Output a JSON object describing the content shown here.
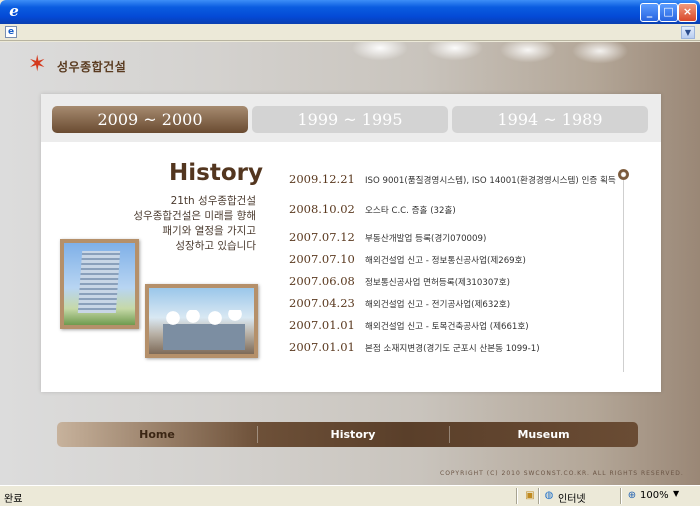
{
  "window": {
    "min_glyph": "_",
    "max_glyph": "□",
    "close_glyph": "×"
  },
  "brand": {
    "logo_text": "성우종합건설",
    "accent": "#6a4b31",
    "star_color": "#d43a1e"
  },
  "tabs": [
    {
      "label": "2009 ~ 2000",
      "active": true
    },
    {
      "label": "1999 ~ 1995",
      "active": false
    },
    {
      "label": "1994 ~ 1989",
      "active": false
    }
  ],
  "intro": {
    "title": "History",
    "line1": "21th 성우종합건설",
    "line2": "성우종합건설은 미래를 향해",
    "line3": "패기와 열정을 가지고",
    "line4": "성장하고 있습니다"
  },
  "timeline": [
    {
      "date": "2009.12.21",
      "event": "ISO 9001(품질경영시스템), ISO 14001(환경경영시스템) 인증 획득"
    },
    {
      "date": "2008.10.02",
      "event": "오스타 C.C. 증홀 (32홀)"
    },
    {
      "date": "2007.07.12",
      "event": "부동산개발업 등록(경기070009)"
    },
    {
      "date": "2007.07.10",
      "event": "해외건설업 신고 - 정보통신공사업(제269호)"
    },
    {
      "date": "2007.06.08",
      "event": "정보통신공사업 면허등록(제310307호)"
    },
    {
      "date": "2007.04.23",
      "event": "해외건설업 신고 - 전기공사업(제632호)"
    },
    {
      "date": "2007.01.01",
      "event": "해외건설업 신고 - 토목건축공사업 (제661호)"
    },
    {
      "date": "2007.01.01",
      "event": "본점 소재지변경(경기도 군포시 산본동 1099-1)"
    }
  ],
  "nav": {
    "home": "Home",
    "history": "History",
    "museum": "Museum"
  },
  "copyright": "COPYRIGHT (C) 2010 SWCONST.CO.KR. ALL RIGHTS RESERVED.",
  "status": {
    "text": "완료",
    "zone": "인터넷",
    "zoom": "100%"
  }
}
